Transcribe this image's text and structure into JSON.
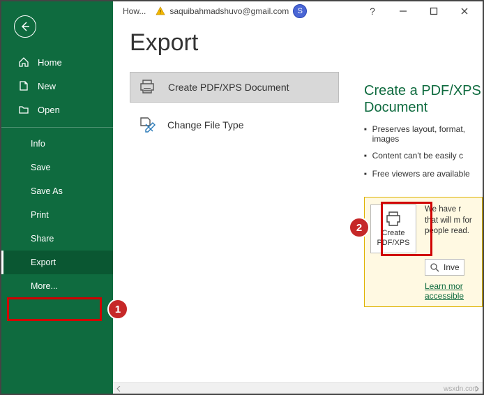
{
  "titlebar": {
    "doc_name": "How...",
    "user_email": "saquibahmadshuvo@gmail.com",
    "avatar_initial": "S"
  },
  "sidebar": {
    "primary": [
      {
        "label": "Home",
        "icon": "home"
      },
      {
        "label": "New",
        "icon": "new"
      },
      {
        "label": "Open",
        "icon": "open"
      }
    ],
    "secondary": [
      {
        "label": "Info"
      },
      {
        "label": "Save"
      },
      {
        "label": "Save As"
      },
      {
        "label": "Print"
      },
      {
        "label": "Share"
      },
      {
        "label": "Export",
        "selected": true
      },
      {
        "label": "More..."
      }
    ]
  },
  "page": {
    "title": "Export",
    "options": [
      {
        "label": "Create PDF/XPS Document",
        "icon": "printer",
        "selected": true
      },
      {
        "label": "Change File Type",
        "icon": "change-type"
      }
    ]
  },
  "info": {
    "title": "Create a PDF/XPS Document",
    "bullets": [
      "Preserves layout, format, images",
      "Content can't be easily c",
      "Free viewers are available"
    ]
  },
  "yellow": {
    "create_btn_line1": "Create",
    "create_btn_line2": "PDF/XPS",
    "text": "We have r that will m for people read.",
    "investigate_label": "Inve",
    "link_text": "Learn mor accessible"
  },
  "callouts": {
    "one": "1",
    "two": "2"
  },
  "watermark": "wsxdn.com"
}
